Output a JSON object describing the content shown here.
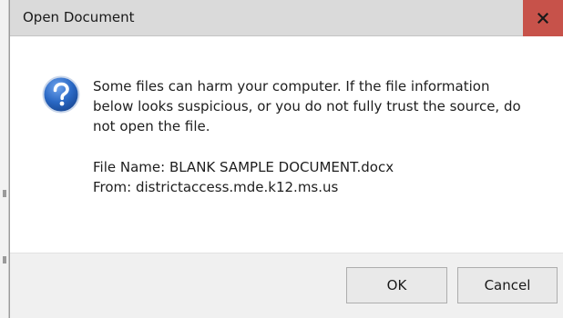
{
  "dialog": {
    "title": "Open Document",
    "close_glyph": "x",
    "icon": "question-icon",
    "message": "Some files can harm your computer. If the file information below looks suspicious, or you do not fully trust the source, do not open the file.",
    "file_name_line": "File Name: BLANK SAMPLE DOCUMENT.docx",
    "from_line": "From: districtaccess.mde.k12.ms.us",
    "buttons": {
      "ok_label": "OK",
      "cancel_label": "Cancel"
    }
  },
  "colors": {
    "close_button": "#c7524a",
    "titlebar": "#dadada",
    "footer": "#f0f0f0",
    "icon_blue": "#2a68c4"
  }
}
